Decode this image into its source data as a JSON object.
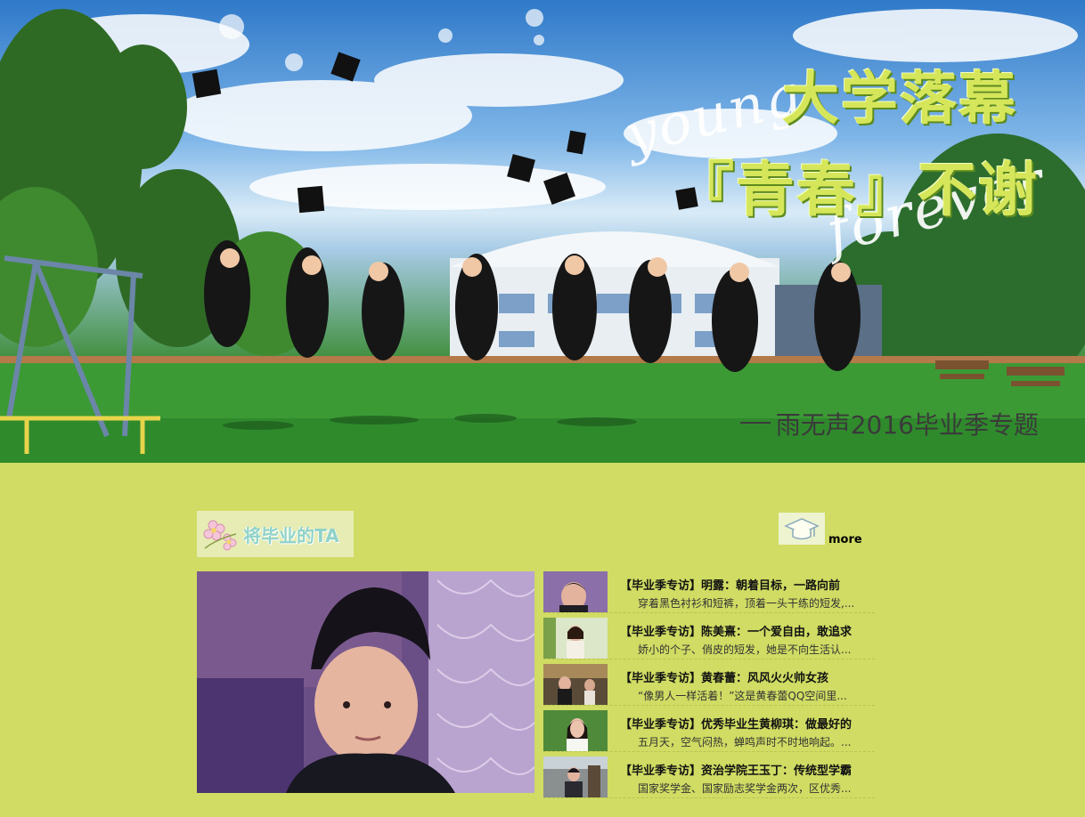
{
  "banner": {
    "title_line1": "大学落幕",
    "title_line2": "『青春』不谢",
    "script_word1": "young",
    "script_word2": "forever",
    "subtitle": "雨无声2016毕业季专题"
  },
  "section": {
    "title": "将毕业的TA",
    "more_label": "more",
    "icons": {
      "title": "flower-icon",
      "more": "graduation-cap-icon"
    }
  },
  "articles": [
    {
      "title": "【毕业季专访】明露：朝着目标，一路向前",
      "summary": "穿着黑色衬衫和短裤，顶着一头干练的短发,..."
    },
    {
      "title": "【毕业季专访】陈美熹：一个爱自由，敢追求",
      "summary": "娇小的个子、俏皮的短发，她是不向生活认..."
    },
    {
      "title": "【毕业季专访】黄春蕾：风风火火帅女孩",
      "summary": "“像男人一样活着！”这是黄春蕾QQ空间里..."
    },
    {
      "title": "【毕业季专访】优秀毕业生黄柳琪：做最好的",
      "summary": "五月天，空气闷热，蝉鸣声时不时地响起。..."
    },
    {
      "title": "【毕业季专访】资治学院王玉丁：传统型学霸",
      "summary": "国家奖学金、国家励志奖学金两次，区优秀..."
    }
  ],
  "colors": {
    "page_background": "#d0dc63",
    "title_green": "#d6e65a",
    "section_title": "#8fd2c8"
  }
}
